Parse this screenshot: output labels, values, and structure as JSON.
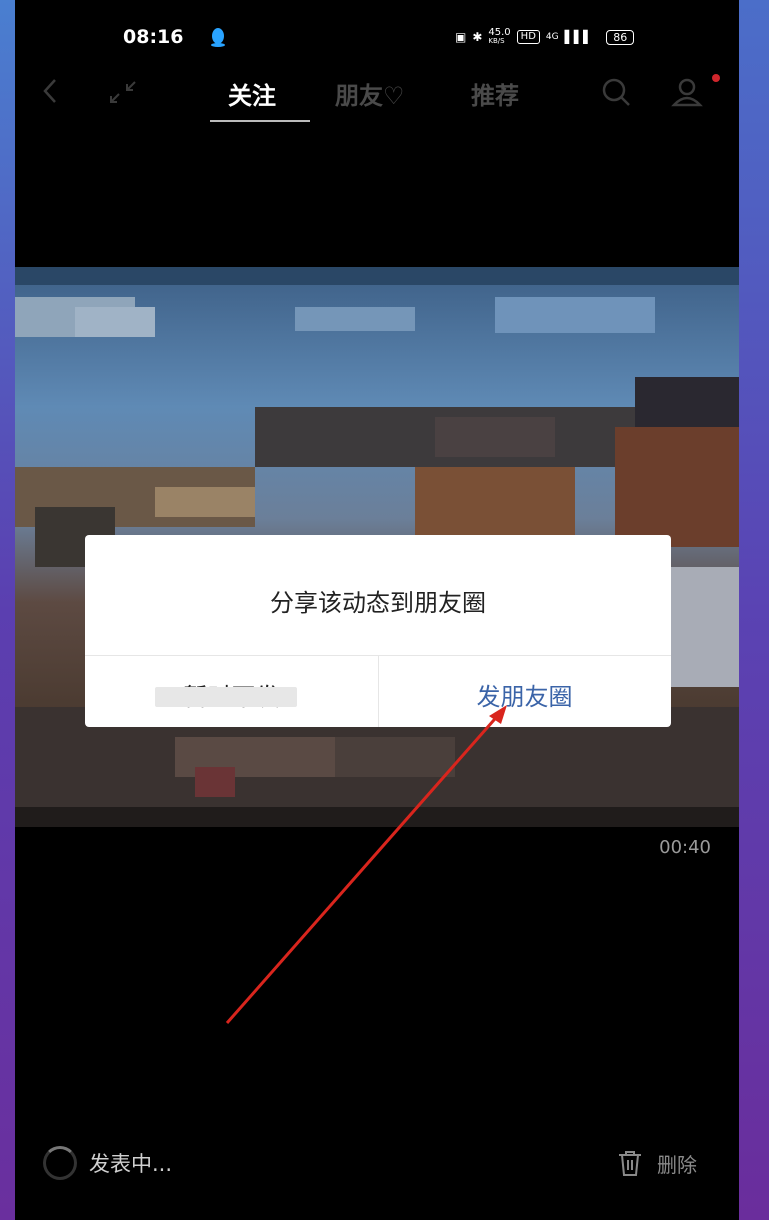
{
  "status_bar": {
    "time": "08:16",
    "network_speed": "45.0",
    "network_unit": "KB/S",
    "hd_label": "HD",
    "signal_label": "4G",
    "battery": "86"
  },
  "nav": {
    "tabs": [
      {
        "label": "关注",
        "active": true
      },
      {
        "label": "朋友♡",
        "active": false
      },
      {
        "label": "推荐",
        "active": false
      }
    ]
  },
  "video": {
    "duration": "00:40"
  },
  "dialog": {
    "title": "分享该动态到朋友圈",
    "cancel_label": "暂时不发",
    "confirm_label": "发朋友圈"
  },
  "bottom": {
    "posting_label": "发表中...",
    "delete_label": "删除"
  },
  "colors": {
    "accent": "#3b64a8",
    "annotation_arrow": "#d9251d",
    "notification_dot": "#d0262c"
  }
}
